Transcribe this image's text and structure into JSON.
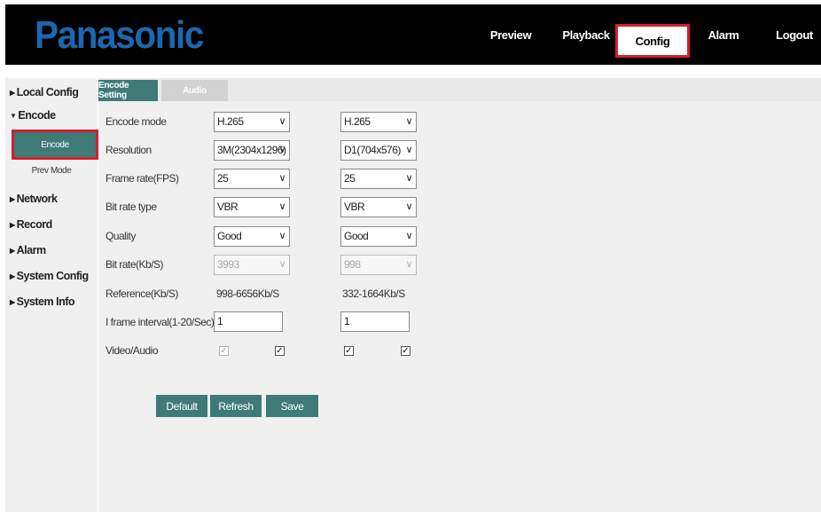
{
  "brand": {
    "logo_text": "Panasonic",
    "logo_color": "#1b67b0"
  },
  "topnav": {
    "items": [
      "Preview",
      "Playback",
      "Config",
      "Alarm",
      "Logout"
    ],
    "active": "Config"
  },
  "sidebar": {
    "items": [
      "Local Config",
      "Encode",
      "Network",
      "Record",
      "Alarm",
      "System Config",
      "System Info"
    ],
    "encode_subitems": [
      "Encode",
      "Prev Mode"
    ],
    "active_subitem": "Encode"
  },
  "tabs": [
    "Encode Setting",
    "Audio"
  ],
  "form": {
    "labels": {
      "encode_mode": "Encode mode",
      "resolution": "Resolution",
      "frame_rate": "Frame rate(FPS)",
      "bit_rate_type": "Bit rate type",
      "quality": "Quality",
      "bit_rate": "Bit rate(Kb/S)",
      "reference": "Reference(Kb/S)",
      "iframe": "I frame interval(1-20/Sec)",
      "video_audio": "Video/Audio"
    },
    "main_stream": {
      "encode_mode": "H.265",
      "resolution": "3M(2304x1296)",
      "frame_rate": "25",
      "bit_rate_type": "VBR",
      "quality": "Good",
      "bit_rate": "3993",
      "reference": "998-6656Kb/S",
      "iframe": "1",
      "video_checked": true,
      "audio_checked": true
    },
    "sub_stream": {
      "encode_mode": "H.265",
      "resolution": "D1(704x576)",
      "frame_rate": "25",
      "bit_rate_type": "VBR",
      "quality": "Good",
      "bit_rate": "998",
      "reference": "332-1664Kb/S",
      "iframe": "1",
      "video_checked": true,
      "audio_checked": true
    }
  },
  "buttons": {
    "default": "Default",
    "refresh": "Refresh",
    "save": "Save"
  },
  "icons": {
    "dropdown": "chevron-down-icon",
    "tree_collapsed": "triangle-right-icon",
    "tree_expanded": "triangle-down-icon",
    "check": "check-icon"
  },
  "colors": {
    "accent": "#3d7a78",
    "highlight": "#d51e2a",
    "topbar": "#000000",
    "panel": "#f0f0f0"
  }
}
